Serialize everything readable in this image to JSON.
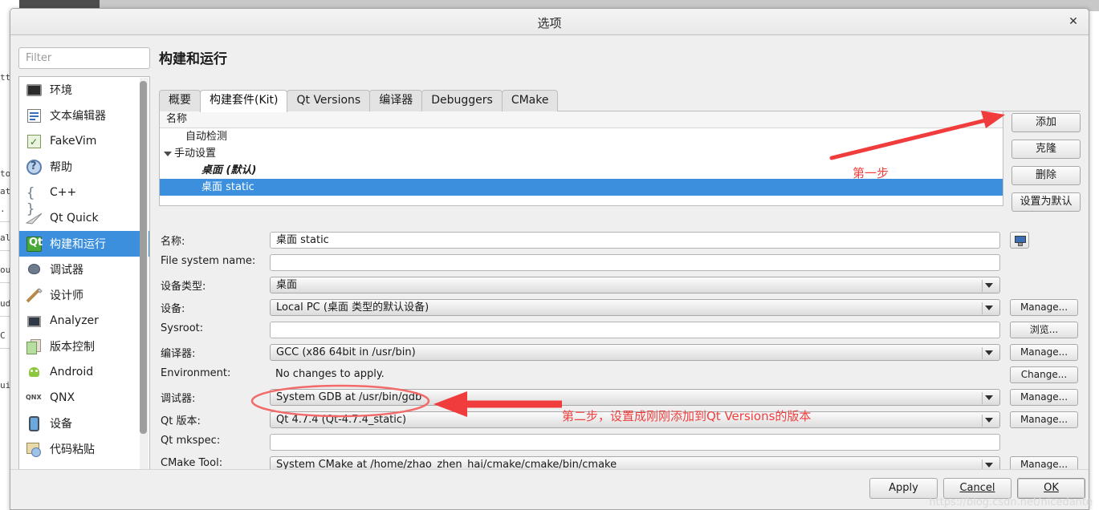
{
  "window": {
    "title": "选项",
    "close_label": "✕"
  },
  "sidebar": {
    "filter_placeholder": "Filter",
    "items": [
      {
        "label": "环境",
        "icon": "monitor-icon",
        "selected": false
      },
      {
        "label": "文本编辑器",
        "icon": "text-editor-icon",
        "selected": false
      },
      {
        "label": "FakeVim",
        "icon": "fakevim-icon",
        "selected": false
      },
      {
        "label": "帮助",
        "icon": "help-icon",
        "selected": false
      },
      {
        "label": "C++",
        "icon": "braces-icon",
        "selected": false
      },
      {
        "label": "Qt Quick",
        "icon": "qtquick-icon",
        "selected": false
      },
      {
        "label": "构建和运行",
        "icon": "build-run-icon",
        "selected": true
      },
      {
        "label": "调试器",
        "icon": "bug-icon",
        "selected": false
      },
      {
        "label": "设计师",
        "icon": "designer-icon",
        "selected": false
      },
      {
        "label": "Analyzer",
        "icon": "analyzer-icon",
        "selected": false
      },
      {
        "label": "版本控制",
        "icon": "version-control-icon",
        "selected": false
      },
      {
        "label": "Android",
        "icon": "android-icon",
        "selected": false
      },
      {
        "label": "QNX",
        "icon": "qnx-icon",
        "selected": false
      },
      {
        "label": "设备",
        "icon": "device-icon",
        "selected": false
      },
      {
        "label": "代码粘贴",
        "icon": "code-paste-icon",
        "selected": false
      }
    ]
  },
  "panel": {
    "heading": "构建和运行",
    "tabs": [
      {
        "label": "概要",
        "active": false
      },
      {
        "label": "构建套件(Kit)",
        "active": true
      },
      {
        "label": "Qt Versions",
        "active": false
      },
      {
        "label": "编译器",
        "active": false
      },
      {
        "label": "Debuggers",
        "active": false
      },
      {
        "label": "CMake",
        "active": false
      }
    ],
    "kit_list": {
      "header": "名称",
      "rows": [
        {
          "label": "自动检测",
          "level": "indent1",
          "selected": false,
          "expander": false
        },
        {
          "label": "手动设置",
          "level": "group",
          "selected": false,
          "expander": true
        },
        {
          "label": "桌面 (默认)",
          "level": "indent2",
          "selected": false,
          "expander": false
        },
        {
          "label": "桌面 static",
          "level": "indent2",
          "selected": true,
          "expander": false
        }
      ]
    },
    "list_buttons": [
      {
        "label": "添加"
      },
      {
        "label": "克隆"
      },
      {
        "label": "删除"
      },
      {
        "label": "设置为默认"
      }
    ],
    "form_rows": [
      {
        "label": "名称:",
        "value": "桌面 static",
        "type": "input",
        "side": "monitor"
      },
      {
        "label": "File system name:",
        "value": "",
        "type": "input",
        "side": ""
      },
      {
        "label": "设备类型:",
        "value": "桌面",
        "type": "combo",
        "side": ""
      },
      {
        "label": "设备:",
        "value": "Local PC (桌面 类型的默认设备)",
        "type": "combo",
        "side": "Manage..."
      },
      {
        "label": "Sysroot:",
        "value": "",
        "type": "input",
        "side": "浏览..."
      },
      {
        "label": "编译器:",
        "value": "GCC (x86 64bit in /usr/bin)",
        "type": "combo",
        "side": "Manage..."
      },
      {
        "label": "Environment:",
        "value": "No changes to apply.",
        "type": "plain",
        "side": "Change..."
      },
      {
        "label": "调试器:",
        "value": "System GDB at /usr/bin/gdb",
        "type": "combo",
        "side": "Manage..."
      },
      {
        "label": "Qt 版本:",
        "value": "Qt 4.7.4 (Qt-4.7.4_static)",
        "type": "combo",
        "side": "Manage..."
      },
      {
        "label": "Qt mkspec:",
        "value": "",
        "type": "input",
        "side": ""
      },
      {
        "label": "CMake Tool:",
        "value": "System CMake at /home/zhao_zhen_hai/cmake/cmake/bin/cmake",
        "type": "combo",
        "side": "Manage..."
      }
    ]
  },
  "footer": {
    "apply": "Apply",
    "cancel": "Cancel",
    "ok": "OK"
  },
  "annotations": {
    "step1": "第一步",
    "step2": "第二步，设置成刚刚添加到Qt Versions的版本",
    "color": "#ef3f3f"
  },
  "watermark": "https://blog.csdn.net/nicedante",
  "background_text": {
    "lines": [
      "tt",
      "",
      "to",
      "at",
      ".",
      "",
      "al",
      "",
      "ou",
      "",
      "ud",
      "",
      "C",
      "",
      "",
      "ui"
    ]
  }
}
